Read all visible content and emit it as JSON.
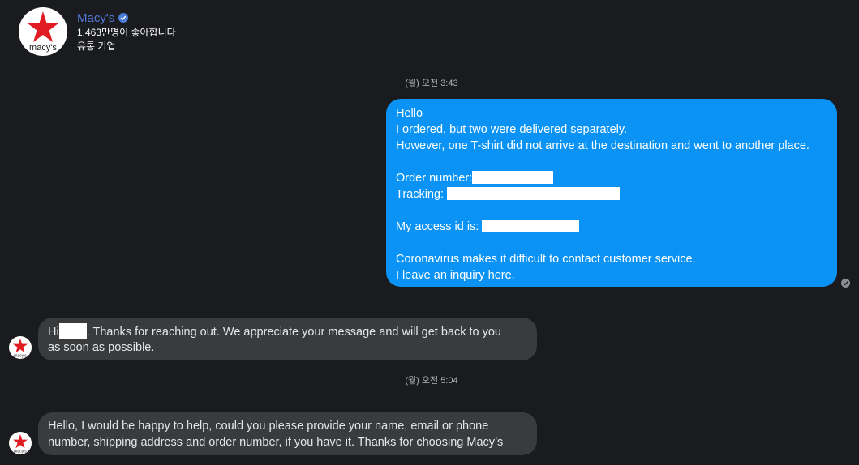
{
  "header": {
    "page_name": "Macy's",
    "logo_text": "macy's",
    "likes": "1,463만명이 좋아합니다",
    "category": "유통 기업"
  },
  "timestamps": [
    "(월) 오전 3:43",
    "(월) 오전 5:04"
  ],
  "outgoing_message": {
    "greeting": "Hello",
    "line1": "I ordered, but two were delivered separately.",
    "line2": "However, one T-shirt did not arrive at the destination and went to another place.",
    "order_label": "Order number:",
    "tracking_label": "Tracking:",
    "access_label": "My access id is:",
    "line3": "Coronavirus makes it difficult to contact customer service.",
    "line4": "I leave an inquiry here."
  },
  "incoming_messages": [
    {
      "prefix": "Hi",
      "suffix": ". Thanks for reaching out. We appreciate your message and will get back to you",
      "line2": "as soon as possible."
    },
    {
      "line1": "Hello, I would be happy to help, could you please provide your name, email or phone",
      "line2": "number, shipping address and order number, if you have it. Thanks for choosing Macy’s"
    }
  ],
  "colors": {
    "background": "#1a1b1e",
    "outgoing_bubble": "#0a93f5",
    "incoming_bubble": "#3a3b3d",
    "brand_red": "#e11b22",
    "page_name": "#5478d4"
  },
  "icons": [
    "macys-star-logo",
    "verified-badge-icon",
    "seen-check-icon"
  ]
}
